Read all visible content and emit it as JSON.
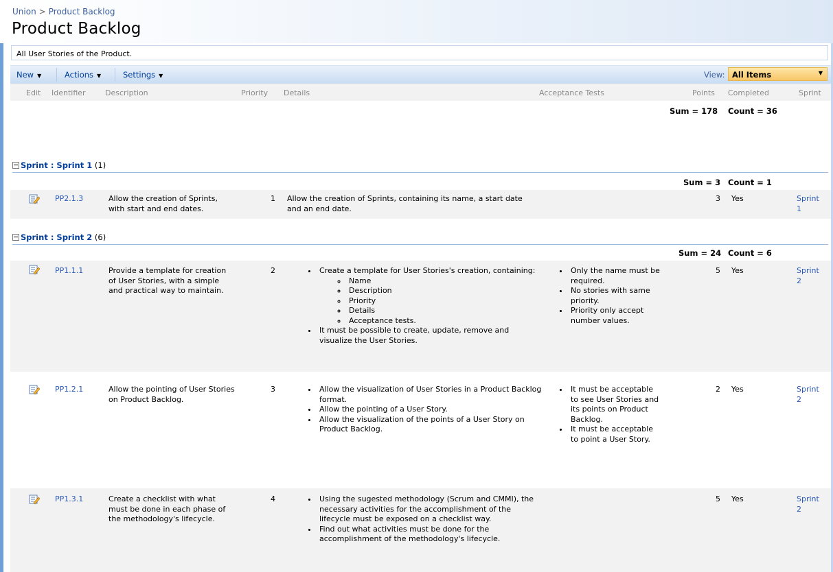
{
  "breadcrumb": {
    "site": "Union",
    "separator": ">",
    "current": "Product Backlog"
  },
  "page_title": "Product Backlog",
  "list_description": "All User Stories of the Product.",
  "toolbar": {
    "new_label": "New",
    "actions_label": "Actions",
    "settings_label": "Settings",
    "view_label": "View:",
    "view_value": "All Items"
  },
  "columns": [
    "Edit",
    "Identifier",
    "Description",
    "Priority",
    "Details",
    "Acceptance Tests",
    "Points",
    "Completed",
    "Sprint"
  ],
  "totals": {
    "sum": "Sum = 178",
    "count": "Count = 36"
  },
  "groups": [
    {
      "field": "Sprint",
      "colon": " : ",
      "value": "Sprint 1",
      "count": "(1)",
      "sum": "Sum = 3",
      "cnt": "Count = 1",
      "rows": [
        {
          "identifier": "PP2.1.3",
          "description": "Allow the creation of Sprints, with start and end dates.",
          "priority": "1",
          "details": "Allow the creation of Sprints, containing its name, a start date and an end date.",
          "points": "3",
          "completed": "Yes",
          "sprint": "Sprint 1"
        }
      ]
    },
    {
      "field": "Sprint",
      "colon": " : ",
      "value": "Sprint 2",
      "count": "(6)",
      "sum": "Sum = 24",
      "cnt": "Count = 6",
      "rows": [
        {
          "identifier": "PP1.1.1",
          "description": "Provide a template for creation of User Stories, with a simple and practical way to maintain.",
          "priority": "2",
          "details_1": "Create a template for User Stories's creation, containing:",
          "details_sub": [
            "Name",
            "Description",
            "Priority",
            "Details",
            "Acceptance tests."
          ],
          "details_2": "It must be possible to create, update, remove and visualize the User Stories.",
          "acceptance": [
            "Only the name must be required.",
            "No stories with same priority.",
            "Priority only accept number values."
          ],
          "points": "5",
          "completed": "Yes",
          "sprint": "Sprint 2"
        },
        {
          "identifier": "PP1.2.1",
          "description": "Allow the pointing of User Stories on Product Backlog.",
          "priority": "3",
          "details": [
            "Allow the visualization of User Stories in a Product Backlog format.",
            "Allow the pointing of a User Story.",
            "Allow the visualization of the points of a User Story on Product Backlog."
          ],
          "acceptance": [
            "It must be acceptable to see User Stories and its points on Product Backlog.",
            "It must be acceptable to point a User Story."
          ],
          "points": "2",
          "completed": "Yes",
          "sprint": "Sprint 2"
        },
        {
          "identifier": "PP1.3.1",
          "description": "Create a checklist with what must be done in each phase of the methodology's lifecycle.",
          "priority": "4",
          "details": [
            "Using the sugested methodology (Scrum and CMMI), the necessary activities for the accomplishment of the lifecycle must be exposed on a checklist way.",
            "Find out what activities must be done for the accomplishment of the methodology's lifecycle."
          ],
          "points": "5",
          "completed": "Yes",
          "sprint": "Sprint 2"
        }
      ]
    }
  ],
  "colors": {
    "link": "#2a5ab6",
    "toolbar_text": "#003d99",
    "view_select": "#f8c668",
    "side_stripe": "#6f9fd8"
  },
  "icons": {
    "edit": "edit-item-icon"
  }
}
